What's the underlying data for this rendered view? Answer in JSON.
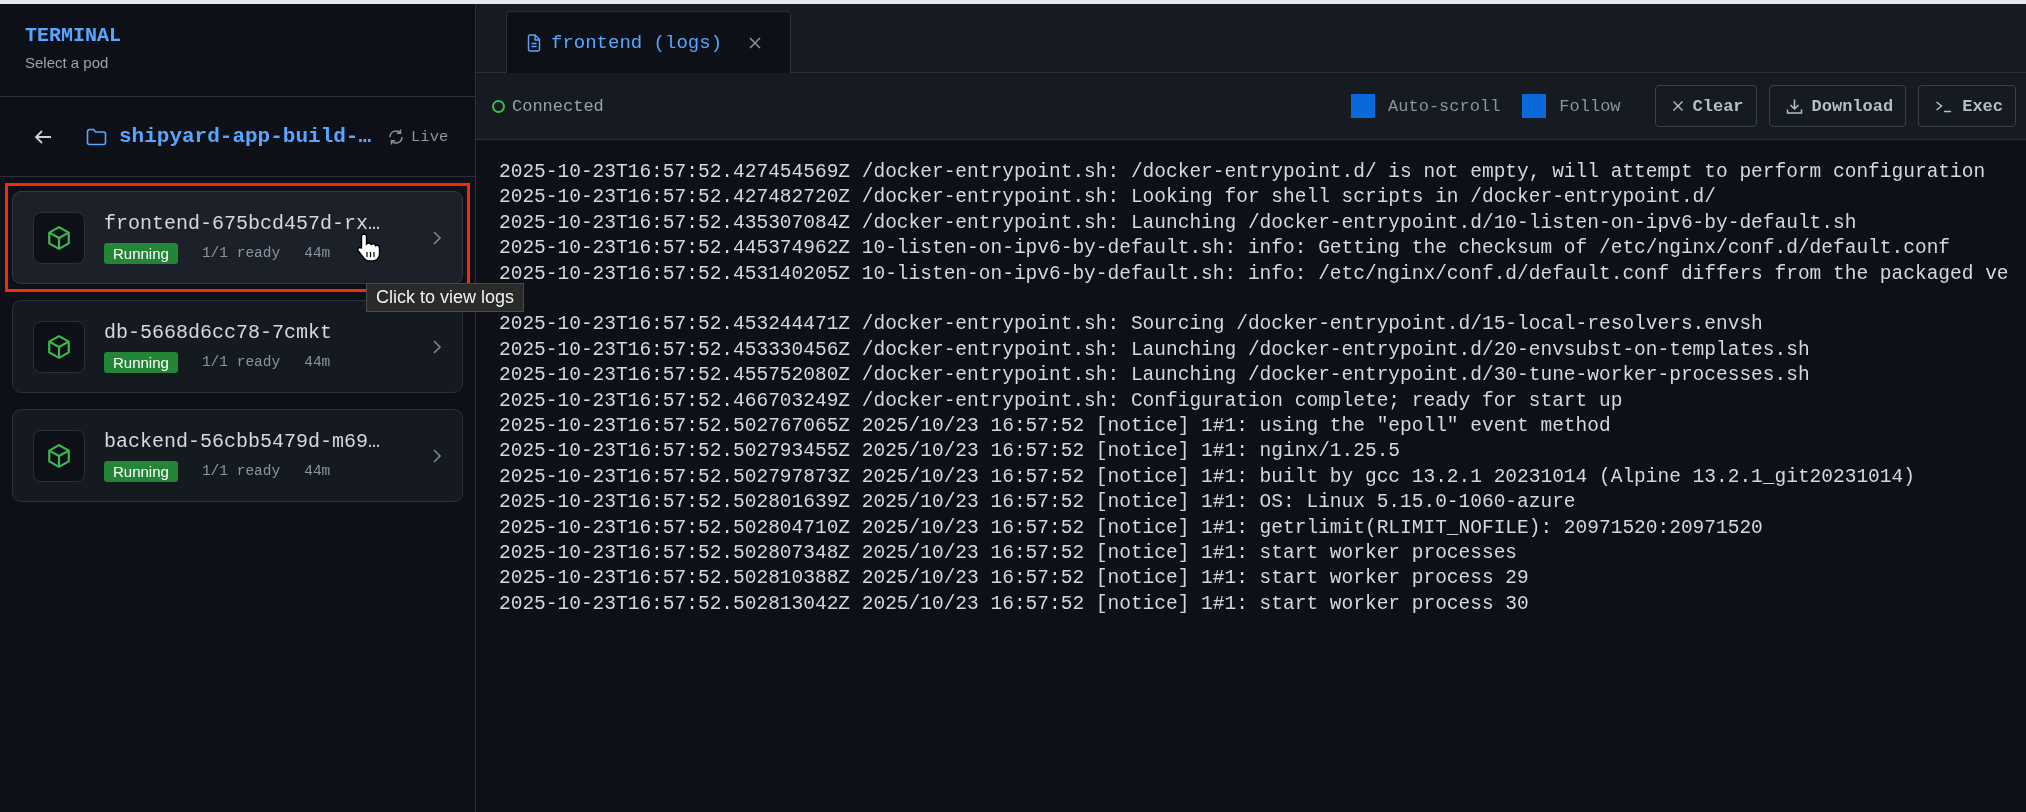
{
  "sidebar": {
    "title": "TERMINAL",
    "subtitle": "Select a pod",
    "breadcrumb": {
      "namespace": "shipyard-app-build-…",
      "live": "Live"
    },
    "pods": [
      {
        "name": "frontend-675bcd457d-rx…",
        "status": "Running",
        "ready": "1/1 ready",
        "age": "44m",
        "selected": true
      },
      {
        "name": "db-5668d6cc78-7cmkt",
        "status": "Running",
        "ready": "1/1 ready",
        "age": "44m",
        "selected": false
      },
      {
        "name": "backend-56cbb5479d-m69…",
        "status": "Running",
        "ready": "1/1 ready",
        "age": "44m",
        "selected": false
      }
    ],
    "tooltip": "Click to view logs"
  },
  "tabs": [
    {
      "label": "frontend (logs)",
      "selected": true
    }
  ],
  "toolbar": {
    "connection": "Connected",
    "connected": true,
    "options": [
      {
        "label": "Auto-scroll",
        "checked": true
      },
      {
        "label": "Follow",
        "checked": true
      }
    ],
    "buttons": [
      {
        "label": "Clear",
        "kind": "clear"
      },
      {
        "label": "Download",
        "kind": "download"
      },
      {
        "label": "Exec",
        "kind": "exec"
      }
    ]
  },
  "log": {
    "lines": [
      {
        "kind": "line",
        "text": "2025-10-23T16:57:52.427454569Z /docker-entrypoint.sh: /docker-entrypoint.d/ is not empty, will attempt to perform configuration"
      },
      {
        "kind": "line",
        "text": "2025-10-23T16:57:52.427482720Z /docker-entrypoint.sh: Looking for shell scripts in /docker-entrypoint.d/"
      },
      {
        "kind": "line",
        "text": "2025-10-23T16:57:52.435307084Z /docker-entrypoint.sh: Launching /docker-entrypoint.d/10-listen-on-ipv6-by-default.sh"
      },
      {
        "kind": "line",
        "text": "2025-10-23T16:57:52.445374962Z 10-listen-on-ipv6-by-default.sh: info: Getting the checksum of /etc/nginx/conf.d/default.conf"
      },
      {
        "kind": "line",
        "text": "2025-10-23T16:57:52.453140205Z 10-listen-on-ipv6-by-default.sh: info: /etc/nginx/conf.d/default.conf differs from the packaged ve"
      },
      {
        "kind": "blank"
      },
      {
        "kind": "line",
        "text": "2025-10-23T16:57:52.453244471Z /docker-entrypoint.sh: Sourcing /docker-entrypoint.d/15-local-resolvers.envsh"
      },
      {
        "kind": "line",
        "text": "2025-10-23T16:57:52.453330456Z /docker-entrypoint.sh: Launching /docker-entrypoint.d/20-envsubst-on-templates.sh"
      },
      {
        "kind": "line",
        "text": "2025-10-23T16:57:52.455752080Z /docker-entrypoint.sh: Launching /docker-entrypoint.d/30-tune-worker-processes.sh"
      },
      {
        "kind": "line",
        "text": "2025-10-23T16:57:52.466703249Z /docker-entrypoint.sh: Configuration complete; ready for start up"
      },
      {
        "kind": "line",
        "text": "2025-10-23T16:57:52.502767065Z 2025/10/23 16:57:52 [notice] 1#1: using the \"epoll\" event method"
      },
      {
        "kind": "line",
        "text": "2025-10-23T16:57:52.502793455Z 2025/10/23 16:57:52 [notice] 1#1: nginx/1.25.5"
      },
      {
        "kind": "line",
        "text": "2025-10-23T16:57:52.502797873Z 2025/10/23 16:57:52 [notice] 1#1: built by gcc 13.2.1 20231014 (Alpine 13.2.1_git20231014)"
      },
      {
        "kind": "line",
        "text": "2025-10-23T16:57:52.502801639Z 2025/10/23 16:57:52 [notice] 1#1: OS: Linux 5.15.0-1060-azure"
      },
      {
        "kind": "line",
        "text": "2025-10-23T16:57:52.502804710Z 2025/10/23 16:57:52 [notice] 1#1: getrlimit(RLIMIT_NOFILE): 20971520:20971520"
      },
      {
        "kind": "line",
        "text": "2025-10-23T16:57:52.502807348Z 2025/10/23 16:57:52 [notice] 1#1: start worker processes"
      },
      {
        "kind": "line",
        "text": "2025-10-23T16:57:52.502810388Z 2025/10/23 16:57:52 [notice] 1#1: start worker process 29"
      },
      {
        "kind": "line",
        "text": "2025-10-23T16:57:52.502813042Z 2025/10/23 16:57:52 [notice] 1#1: start worker process 30"
      }
    ]
  }
}
